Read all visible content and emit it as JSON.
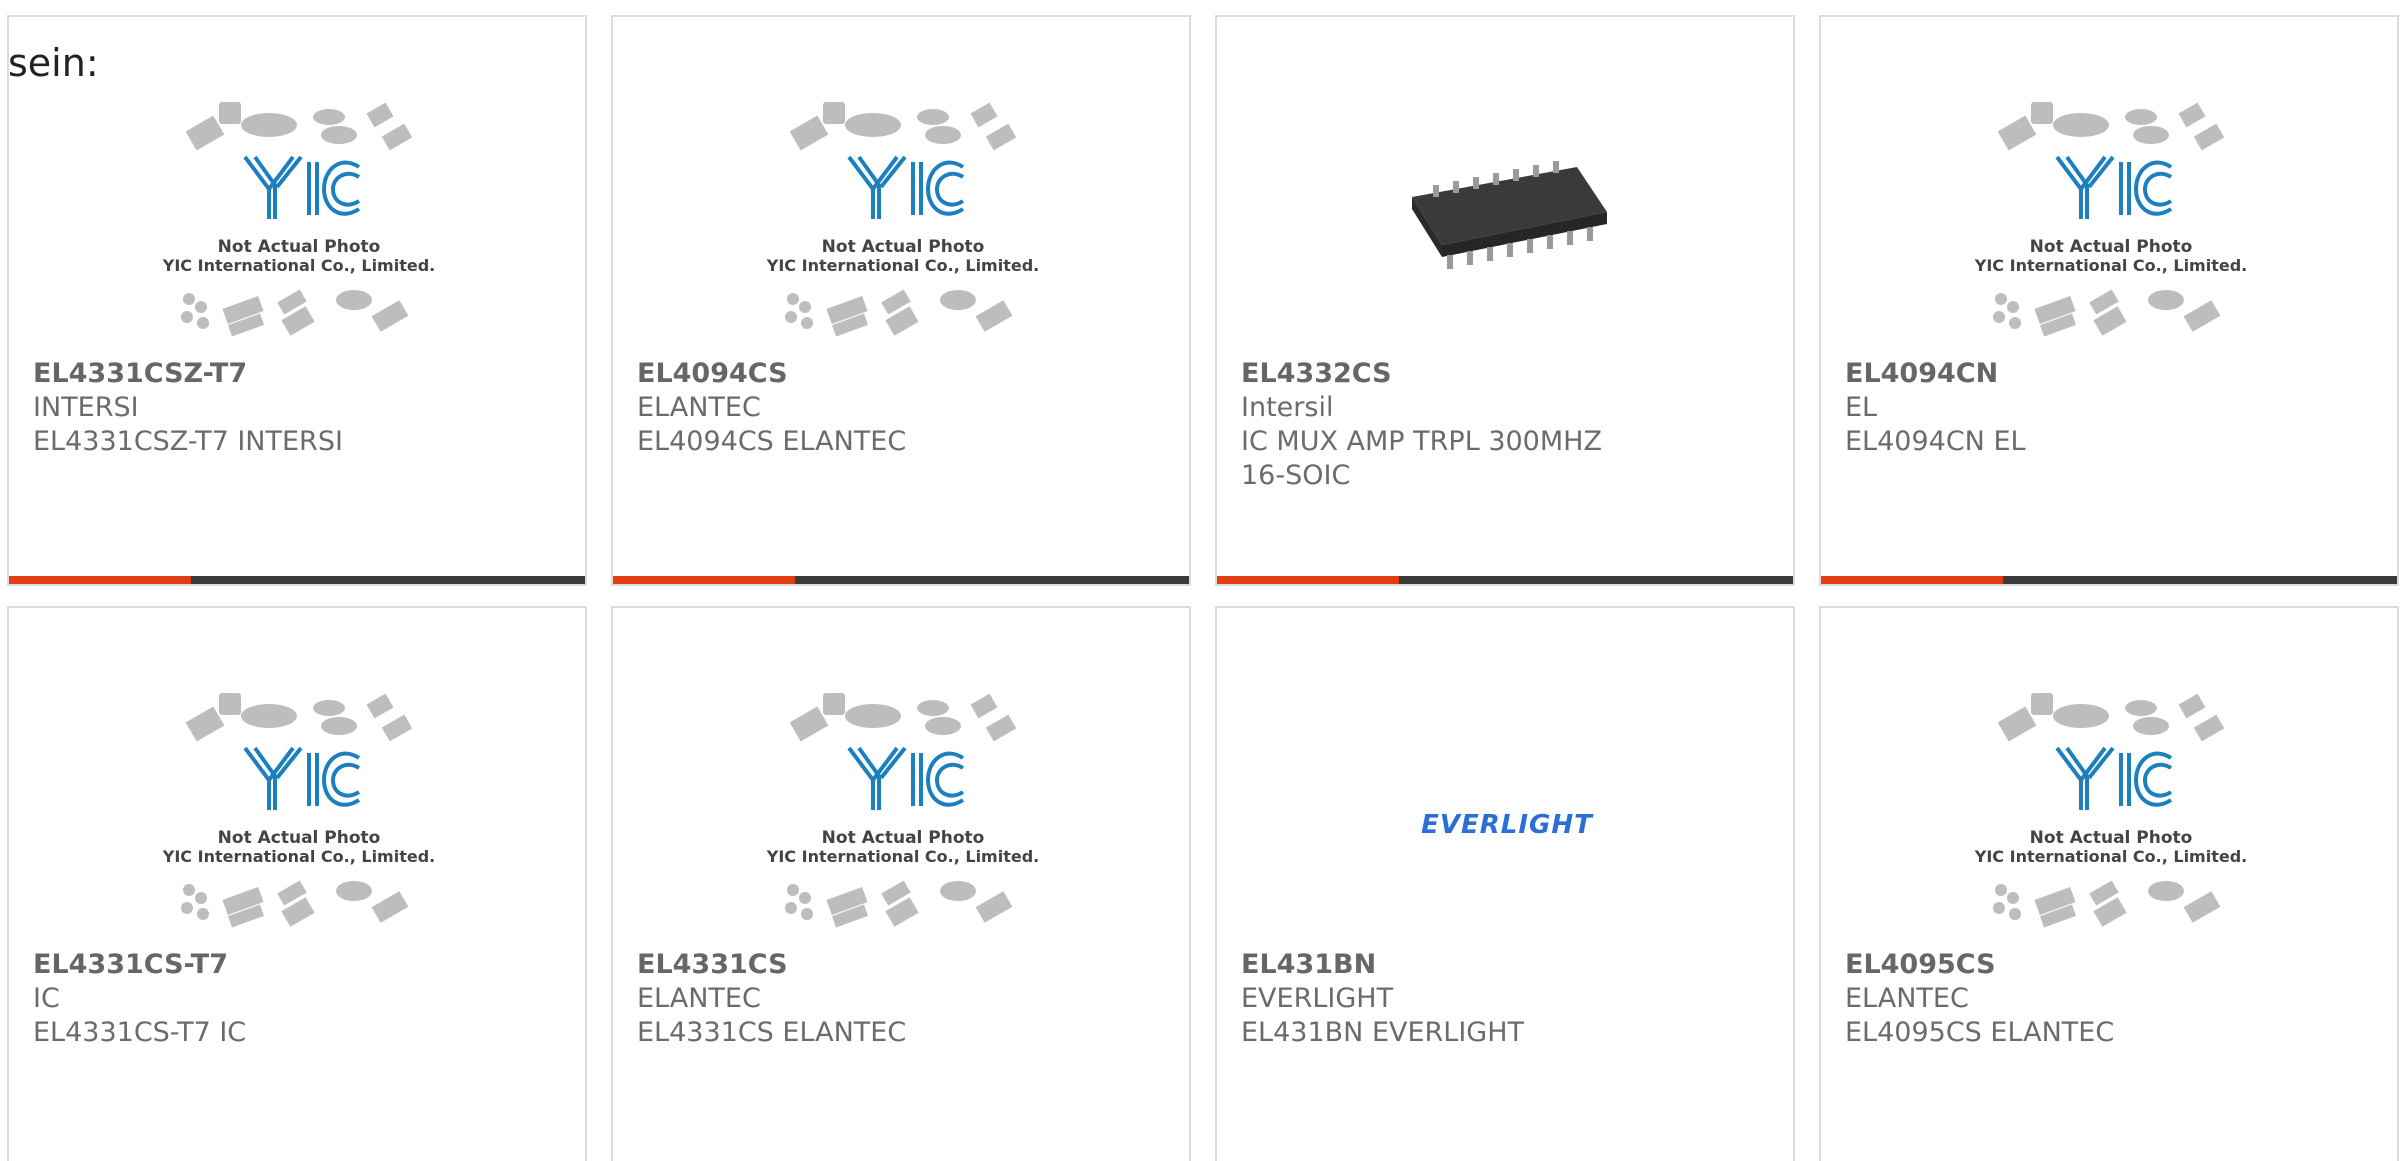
{
  "heading": "sein:",
  "products": [
    {
      "part": "EL4331CSZ-T7",
      "maker": "INTERSI",
      "desc": "EL4331CSZ-T7 INTERSI",
      "image": "yic-placeholder"
    },
    {
      "part": "EL4094CS",
      "maker": "ELANTEC",
      "desc": "EL4094CS ELANTEC",
      "image": "yic-placeholder"
    },
    {
      "part": "EL4332CS",
      "maker": "Intersil",
      "desc": "IC MUX AMP TRPL 300MHZ 16-SOIC",
      "image": "soic-chip-photo"
    },
    {
      "part": "EL4094CN",
      "maker": "EL",
      "desc": "EL4094CN EL",
      "image": "yic-placeholder"
    },
    {
      "part": "EL4331CS-T7",
      "maker": "IC",
      "desc": "EL4331CS-T7 IC",
      "image": "yic-placeholder"
    },
    {
      "part": "EL4331CS",
      "maker": "ELANTEC",
      "desc": "EL4331CS ELANTEC",
      "image": "yic-placeholder"
    },
    {
      "part": "EL431BN",
      "maker": "EVERLIGHT",
      "desc": "EL431BN EVERLIGHT",
      "image": "everlight-logo"
    },
    {
      "part": "EL4095CS",
      "maker": "ELANTEC",
      "desc": "EL4095CS ELANTEC",
      "image": "yic-placeholder"
    }
  ],
  "placeholder": {
    "logo_text": "YIC",
    "line1": "Not Actual Photo",
    "line2": "YIC International Co., Limited."
  },
  "everlight_logo_text": "EVERLIGHT",
  "colors": {
    "accent": "#e23c14",
    "bar": "#3a3a3a",
    "yic_blue": "#1c7fc0",
    "everlight_blue": "#2a6fd6",
    "text": "#6b6b6b"
  }
}
